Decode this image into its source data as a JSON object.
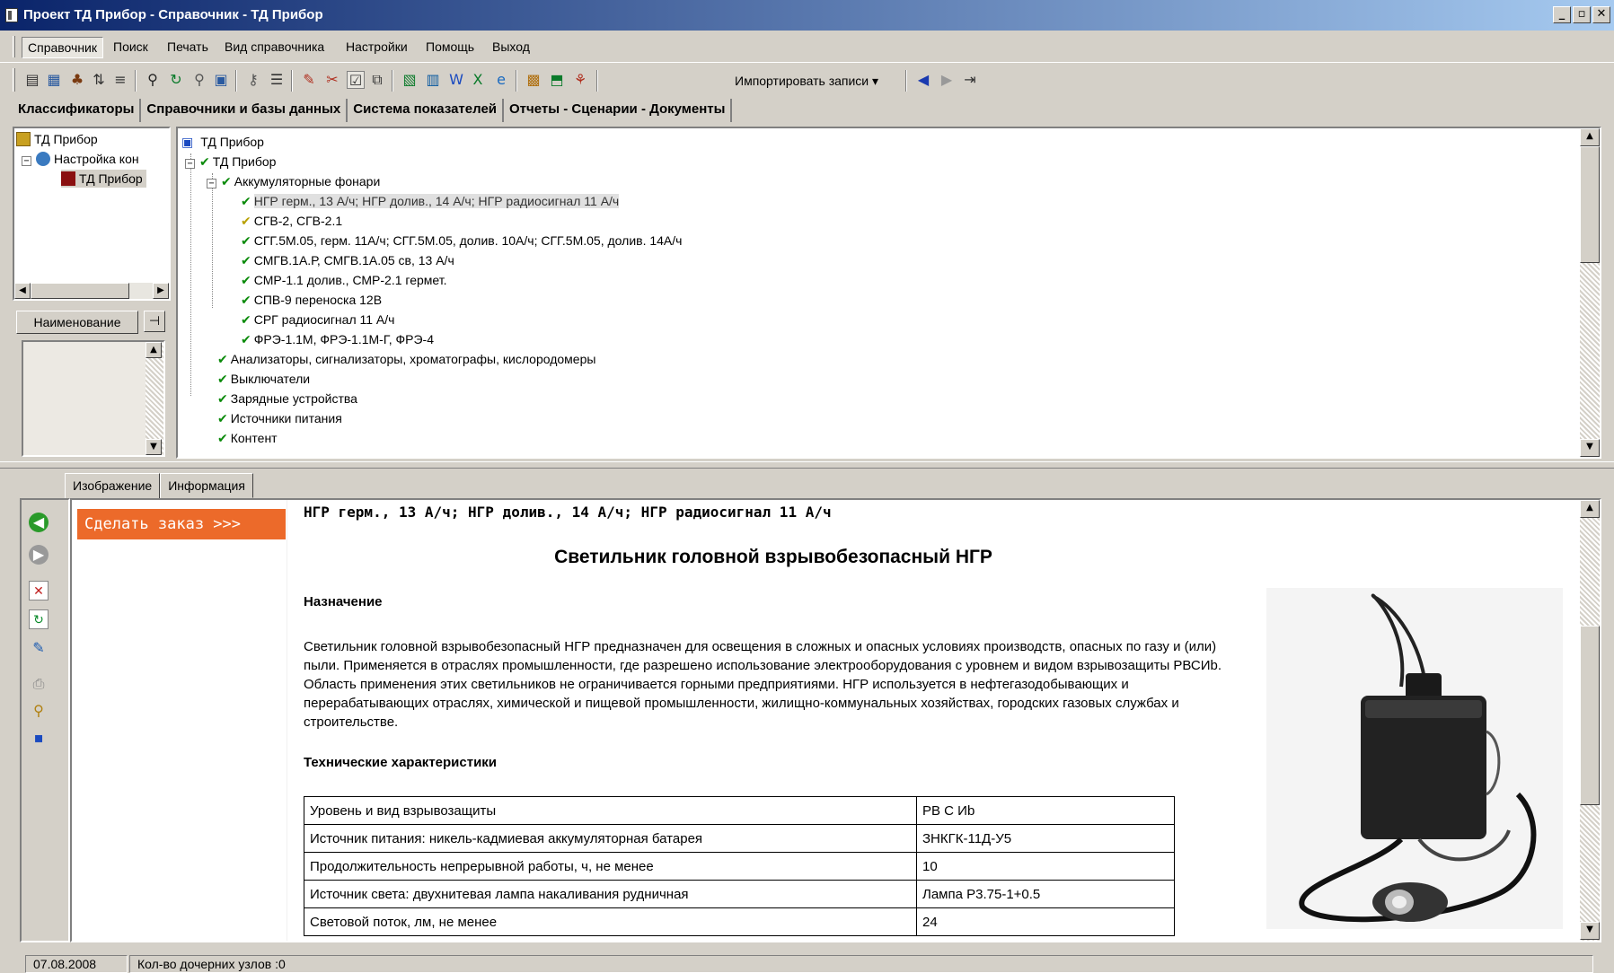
{
  "window": {
    "title": "Проект ТД Прибор - Справочник - ТД Прибор",
    "buttons": [
      "_",
      "▫",
      "✕"
    ]
  },
  "menu": {
    "items": [
      "Справочник",
      "Поиск",
      "Печать",
      "Вид справочника",
      "Настройки",
      "Помощь",
      "Выход"
    ]
  },
  "toolbar": {
    "import_label": "Импортировать записи"
  },
  "top_tabs": [
    "Классификаторы",
    "Справочники и базы данных",
    "Система показателей",
    "Отчеты - Сценарии - Документы"
  ],
  "left_tree": {
    "items": [
      "ТД Прибор",
      "Настройка кон",
      "ТД Прибор"
    ]
  },
  "name_panel": {
    "header": "Наименование"
  },
  "main_tree": {
    "root": "ТД Прибор",
    "node": "ТД Прибор",
    "group": "Аккумуляторные фонари",
    "children": [
      "НГР герм., 13 А/ч; НГР долив., 14 А/ч; НГР радиосигнал 11 А/ч",
      "СГВ-2, СГВ-2.1",
      "СГГ.5М.05, герм. 11А/ч; СГГ.5М.05, долив. 10А/ч; СГГ.5М.05, долив. 14А/ч",
      "СМГВ.1А.Р, СМГВ.1А.05 св, 13 А/ч",
      "СМР-1.1 долив., СМР-2.1 гермет.",
      "СПВ-9 переноска 12В",
      "СРГ радиосигнал 11 А/ч",
      "ФРЭ-1.1М, ФРЭ-1.1М-Г, ФРЭ-4"
    ],
    "siblings": [
      "Анализаторы, сигнализаторы, хроматографы, кислородомеры",
      "Выключатели",
      "Зарядные устройства",
      "Источники питания",
      "Контент"
    ]
  },
  "bottom_tabs": [
    "Изображение",
    "Информация"
  ],
  "content": {
    "order_button": "Сделать заказ >>>",
    "header": "НГР герм., 13 А/ч; НГР долив., 14 А/ч; НГР радиосигнал 11 А/ч",
    "title": "Светильник головной взрывобезопасный  НГР",
    "section1": "Назначение",
    "para1": "Светильник головной взрывобезопасный НГР предназначен для освещения в сложных и опасных условиях производств, опасных по газу и (или) пыли. Применяется в отраслях промышленности, где разрешено использование электрооборудования с уровнем и видом взрывозащиты РВСИb. Область применения этих светильников не ограничивается горными предприятиями. НГР используется в нефтегазодобывающих и перерабатывающих отраслях, химической и пищевой промышленности, жилищно-коммунальных хозяйствах, городских газовых службах и строительстве.",
    "section2": "Технические характеристики",
    "specs": [
      {
        "name": "Уровень и вид взрывозащиты",
        "value": "РВ С Иb"
      },
      {
        "name": "Источник питания: никель-кадмиевая аккумуляторная батарея",
        "value": "ЗНКГК-11Д-У5"
      },
      {
        "name": "Продолжительность непрерывной работы, ч, не менее",
        "value": "10"
      },
      {
        "name": "Источник света: двухнитевая лампа накаливания рудничная",
        "value": "Лампа Р3.75-1+0.5"
      },
      {
        "name": "Световой поток, лм, не менее",
        "value": "24"
      }
    ]
  },
  "status": {
    "date": "07.08.2008",
    "info": "Кол-во дочерних узлов :0"
  },
  "colors": {
    "accent": "#ec6a2a",
    "title_bar": "#0a246a",
    "check": "#0a8a0a"
  }
}
